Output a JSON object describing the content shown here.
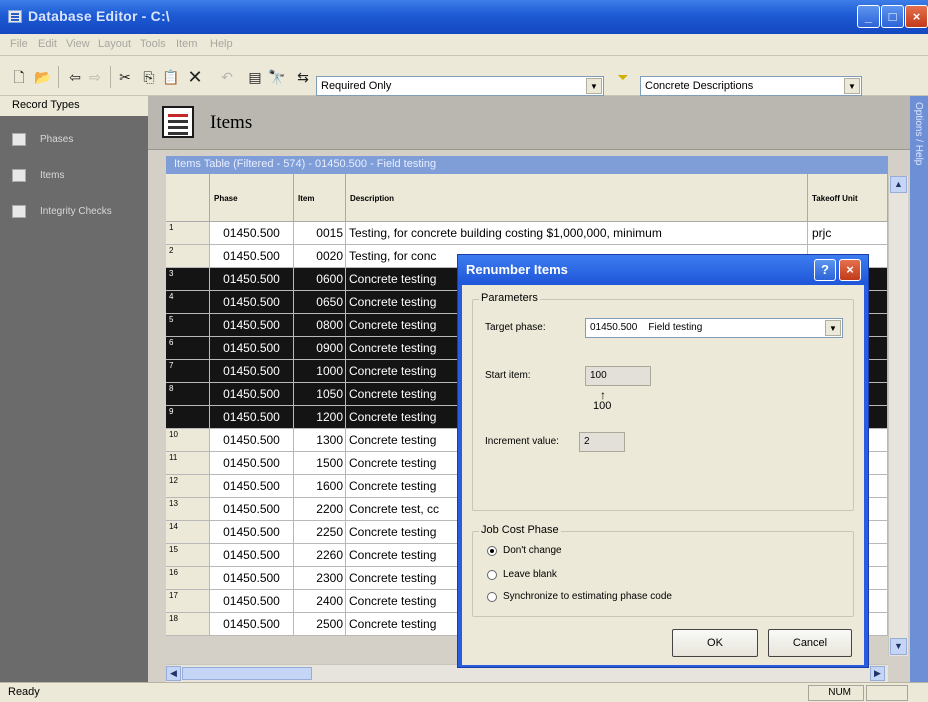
{
  "window": {
    "title": "Database Editor - C:\\",
    "min": "_",
    "max": "□",
    "close": "×"
  },
  "menu": [
    "File",
    "Edit",
    "View",
    "Layout",
    "Tools",
    "Item",
    "Help"
  ],
  "toolbar": {
    "filter_combo": "Required Only",
    "description_combo": "Concrete Descriptions"
  },
  "left_panel": {
    "header": "Record Types",
    "items": [
      {
        "label": "Phases",
        "icon": "phases-icon"
      },
      {
        "label": "Items",
        "icon": "items-icon"
      },
      {
        "label": "Integrity Checks",
        "icon": "integrity-checks-icon"
      }
    ]
  },
  "items_header": {
    "title": "Items"
  },
  "table": {
    "title": "Items Table (Filtered - 574) - 01450.500 - Field testing",
    "columns": [
      "Phase",
      "Item",
      "Description",
      "Takeoff Unit"
    ],
    "rows": [
      {
        "n": "1",
        "phase": "01450.500",
        "item": "0015",
        "description": "Testing, for concrete building costing $1,000,000, minimum",
        "unit": "prjc",
        "selected": false
      },
      {
        "n": "2",
        "phase": "01450.500",
        "item": "0020",
        "description": "Testing, for conc",
        "unit": "",
        "selected": false
      },
      {
        "n": "3",
        "phase": "01450.500",
        "item": "0600",
        "description": "Concrete testing",
        "unit": "",
        "selected": true
      },
      {
        "n": "4",
        "phase": "01450.500",
        "item": "0650",
        "description": "Concrete testing",
        "unit": "",
        "selected": true
      },
      {
        "n": "5",
        "phase": "01450.500",
        "item": "0800",
        "description": "Concrete testing",
        "unit": "",
        "selected": true
      },
      {
        "n": "6",
        "phase": "01450.500",
        "item": "0900",
        "description": "Concrete testing",
        "unit": "",
        "selected": true
      },
      {
        "n": "7",
        "phase": "01450.500",
        "item": "1000",
        "description": "Concrete testing",
        "unit": "",
        "selected": true
      },
      {
        "n": "8",
        "phase": "01450.500",
        "item": "1050",
        "description": "Concrete testing",
        "unit": "",
        "selected": true
      },
      {
        "n": "9",
        "phase": "01450.500",
        "item": "1200",
        "description": "Concrete testing",
        "unit": "",
        "selected": true
      },
      {
        "n": "10",
        "phase": "01450.500",
        "item": "1300",
        "description": "Concrete testing",
        "unit": "",
        "selected": false
      },
      {
        "n": "11",
        "phase": "01450.500",
        "item": "1500",
        "description": "Concrete testing",
        "unit": "",
        "selected": false
      },
      {
        "n": "12",
        "phase": "01450.500",
        "item": "1600",
        "description": "Concrete testing",
        "unit": "",
        "selected": false
      },
      {
        "n": "13",
        "phase": "01450.500",
        "item": "2200",
        "description": "Concrete test, cc",
        "unit": "",
        "selected": false
      },
      {
        "n": "14",
        "phase": "01450.500",
        "item": "2250",
        "description": "Concrete testing",
        "unit": "",
        "selected": false
      },
      {
        "n": "15",
        "phase": "01450.500",
        "item": "2260",
        "description": "Concrete testing",
        "unit": "",
        "selected": false
      },
      {
        "n": "16",
        "phase": "01450.500",
        "item": "2300",
        "description": "Concrete testing",
        "unit": "",
        "selected": false
      },
      {
        "n": "17",
        "phase": "01450.500",
        "item": "2400",
        "description": "Concrete testing",
        "unit": "",
        "selected": false
      },
      {
        "n": "18",
        "phase": "01450.500",
        "item": "2500",
        "description": "Concrete testing",
        "unit": "",
        "selected": false
      }
    ]
  },
  "right_tab": "Options / Help",
  "status": {
    "text": "Ready",
    "num": "NUM"
  },
  "dialog": {
    "title": "Renumber Items",
    "help": "?",
    "close": "×",
    "parameters_legend": "Parameters",
    "target_phase_label": "Target phase:",
    "target_phase_value": "01450.500    Field testing",
    "start_item_label": "Start item:",
    "start_item_value": "100",
    "start_item_overlay": "100",
    "increment_label": "Increment value:",
    "increment_value": "2",
    "job_cost_legend": "Job Cost Phase",
    "options": [
      {
        "label": "Don't change",
        "checked": true
      },
      {
        "label": "Leave blank",
        "checked": false
      },
      {
        "label": "Synchronize to estimating phase code",
        "checked": false
      }
    ],
    "ok": "OK",
    "cancel": "Cancel"
  }
}
